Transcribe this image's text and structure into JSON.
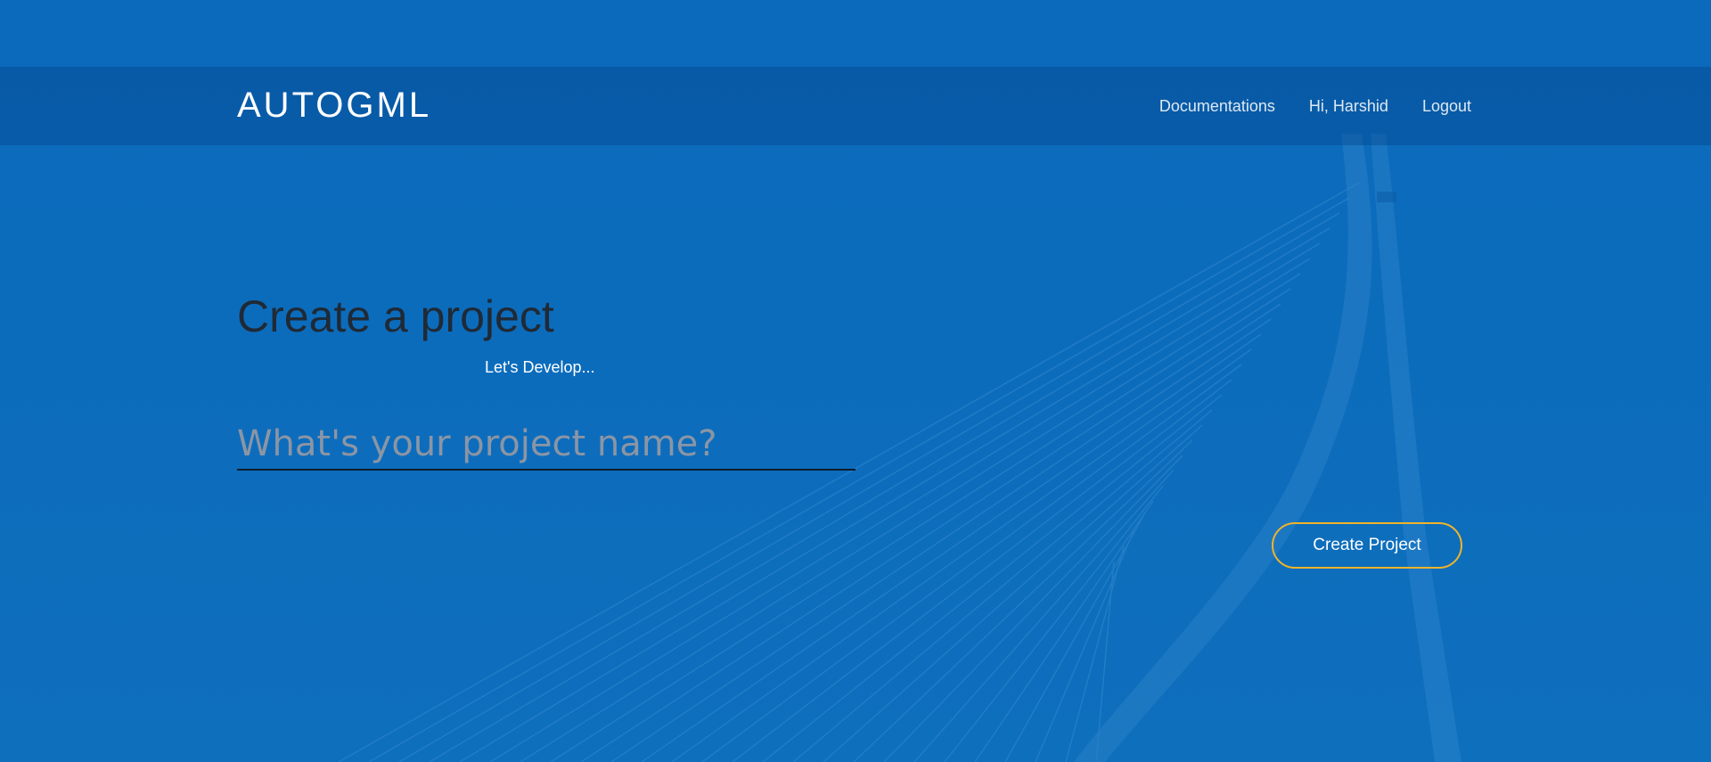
{
  "navbar": {
    "brand": "AUTOGML",
    "links": [
      {
        "label": "Documentations"
      },
      {
        "label": "Hi, Harshid"
      },
      {
        "label": "Logout"
      }
    ]
  },
  "main": {
    "title": "Create a project",
    "subtitle": "Let's Develop...",
    "project_input": {
      "placeholder": "What's your project name?",
      "value": ""
    },
    "create_button_label": "Create Project"
  },
  "colors": {
    "background": "#0b6cba",
    "navbar": "#0a5fa6",
    "button_border": "#f0b429",
    "title": "#1f2a36"
  },
  "icons": {
    "background_image": "cable-stayed-bridge"
  }
}
